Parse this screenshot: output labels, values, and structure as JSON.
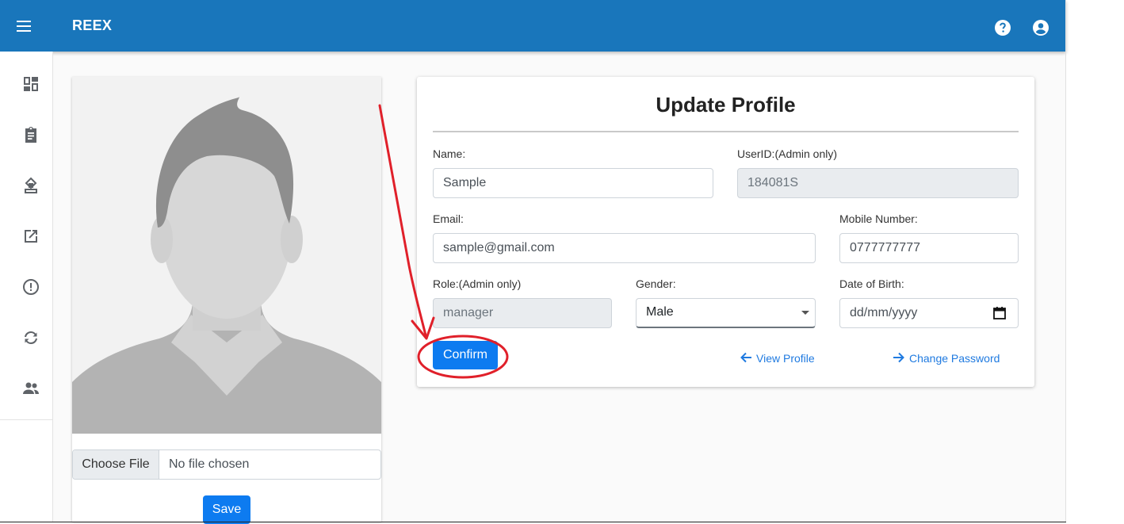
{
  "app": {
    "title": "REEX"
  },
  "topbar": {
    "menu_icon": "hamburger-menu-icon",
    "help_icon": "help-circle-icon",
    "account_icon": "account-circle-icon",
    "color": "#1976bb"
  },
  "sidebar": {
    "items": [
      {
        "icon": "dashboard-icon"
      },
      {
        "icon": "assignment-icon"
      },
      {
        "icon": "approval-stamp-icon"
      },
      {
        "icon": "open-in-new-icon"
      },
      {
        "icon": "alert-circle-icon"
      },
      {
        "icon": "sync-icon"
      },
      {
        "icon": "people-icon"
      }
    ]
  },
  "photo": {
    "choose_file_label": "Choose File",
    "file_status": "No file chosen",
    "save_label": "Save"
  },
  "form": {
    "title": "Update Profile",
    "name": {
      "label": "Name:",
      "value": "Sample"
    },
    "userid": {
      "label": "UserID:(Admin only)",
      "value": "184081S"
    },
    "email": {
      "label": "Email:",
      "value": "sample@gmail.com"
    },
    "mobile": {
      "label": "Mobile Number:",
      "value": "0777777777"
    },
    "role": {
      "label": "Role:(Admin only)",
      "value": "manager"
    },
    "gender": {
      "label": "Gender:",
      "value": "Male"
    },
    "dob": {
      "label": "Date of Birth:",
      "placeholder": "dd/mm/yyyy"
    },
    "confirm_label": "Confirm",
    "view_profile_label": "View Profile",
    "change_password_label": "Change Password"
  },
  "colors": {
    "primary": "#0d7bf0",
    "link": "#1f7ae0",
    "annotation": "#e0202a"
  }
}
